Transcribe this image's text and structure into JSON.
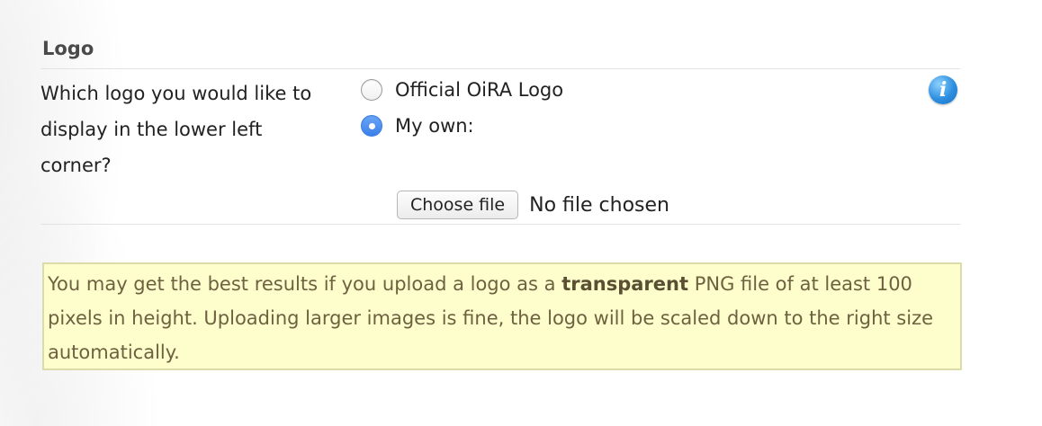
{
  "section": {
    "title": "Logo"
  },
  "logo_choice": {
    "question": "Which logo you would like to display in the lower left corner?",
    "options": [
      {
        "label": "Official OiRA Logo",
        "selected": false
      },
      {
        "label": "My own:",
        "selected": true
      }
    ],
    "info_icon": "info-icon"
  },
  "file_input": {
    "button_label": "Choose file",
    "status": "No file chosen"
  },
  "notice": {
    "before": "You may get the best results if you upload a logo as a ",
    "emphasis": "transparent",
    "after": " PNG file of at least 100 pixels in height. Uploading larger images is fine, the logo will be scaled down to the right size automatically."
  },
  "colors": {
    "notice_bg": "#fefecd",
    "notice_border": "#dcdcaa",
    "radio_selected": "#3b7fe8",
    "info_icon": "#2d8fe0"
  }
}
